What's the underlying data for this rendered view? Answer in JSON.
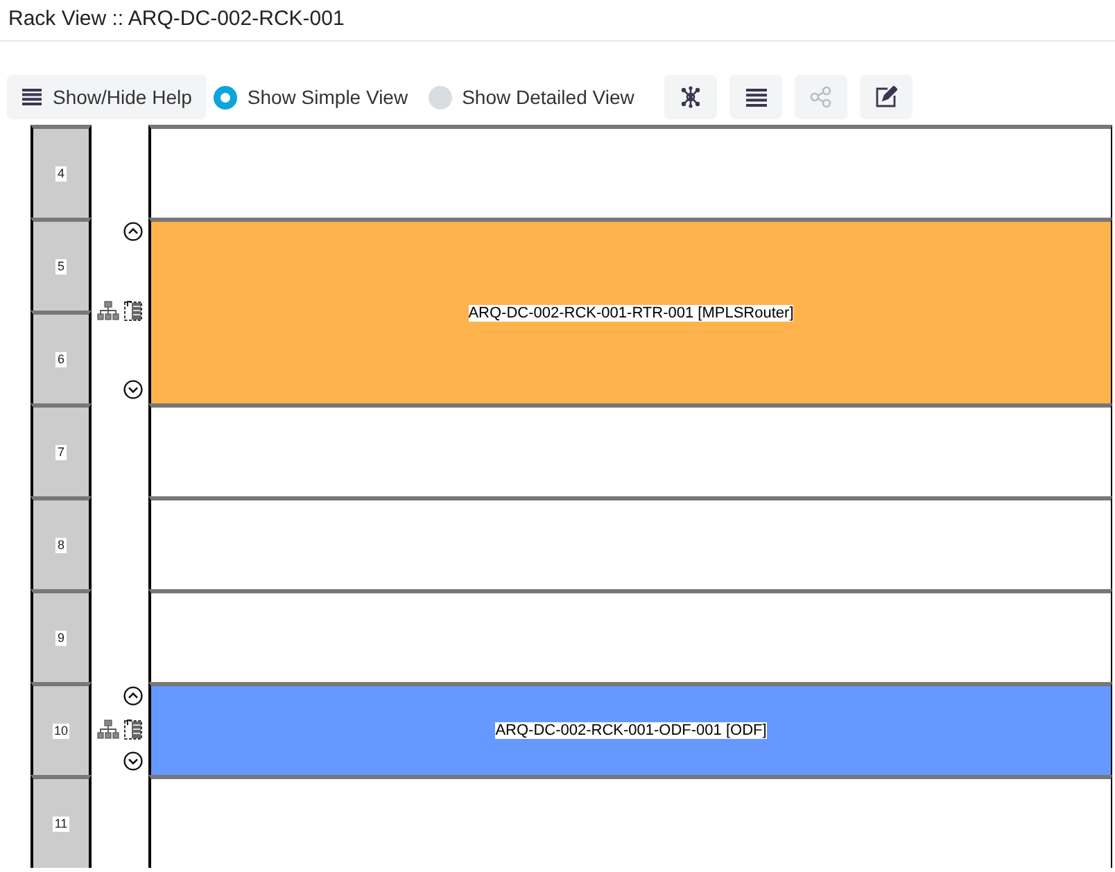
{
  "title": "Rack View :: ARQ-DC-002-RCK-001",
  "help_button": "Show/Hide Help",
  "view_options": [
    {
      "label": "Show Simple View",
      "selected": true
    },
    {
      "label": "Show Detailed View",
      "selected": false
    }
  ],
  "tool_buttons": [
    {
      "kind": "network",
      "disabled": false
    },
    {
      "kind": "list",
      "disabled": false
    },
    {
      "kind": "share",
      "disabled": true
    },
    {
      "kind": "edit",
      "disabled": false
    }
  ],
  "rack": [
    {
      "kind": "empty",
      "units": [
        "4"
      ]
    },
    {
      "kind": "device",
      "units": [
        "5",
        "6"
      ],
      "label": "ARQ-DC-002-RCK-001-RTR-001 [MPLSRouter]",
      "color": "#ffb34d"
    },
    {
      "kind": "empty",
      "units": [
        "7"
      ]
    },
    {
      "kind": "empty",
      "units": [
        "8"
      ]
    },
    {
      "kind": "empty",
      "units": [
        "9"
      ]
    },
    {
      "kind": "device",
      "units": [
        "10"
      ],
      "label": "ARQ-DC-002-RCK-001-ODF-001 [ODF]",
      "color": "#6699ff"
    },
    {
      "kind": "empty",
      "units": [
        "11"
      ]
    }
  ]
}
